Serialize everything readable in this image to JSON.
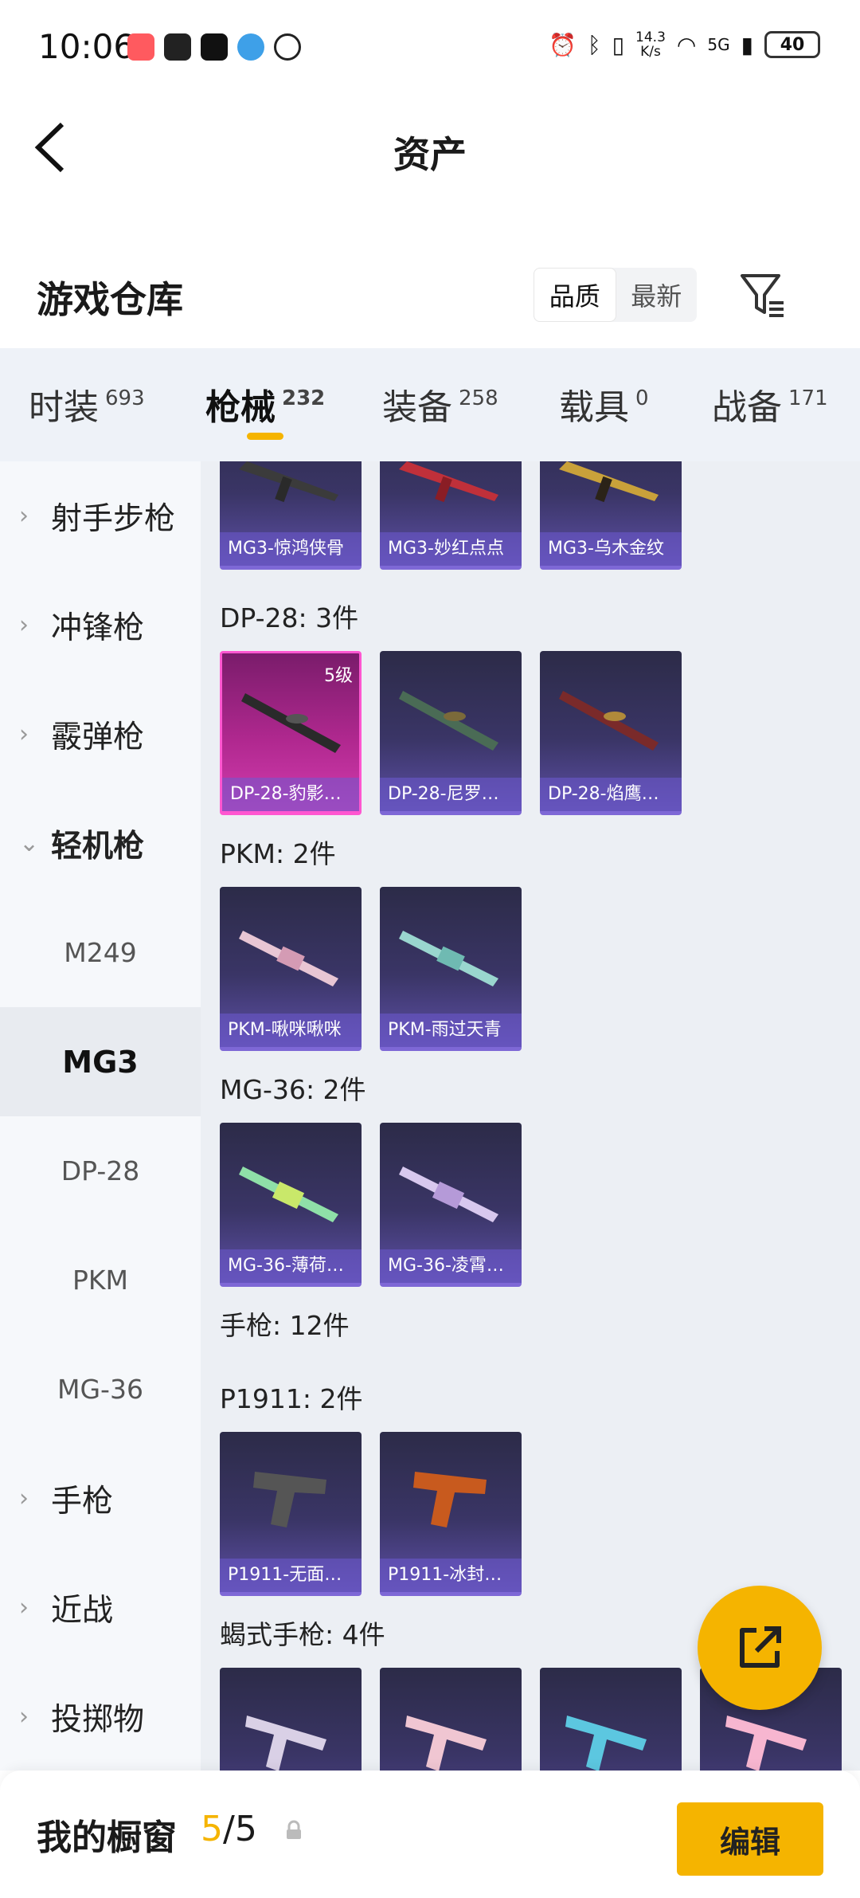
{
  "status": {
    "time": "10:06",
    "net_speed_top": "14.3",
    "net_speed_bottom": "K/s",
    "network": "5G",
    "battery": "40"
  },
  "header": {
    "title": "资产"
  },
  "warehouse": {
    "title": "游戏仓库",
    "sort_quality": "品质",
    "sort_latest": "最新"
  },
  "categories": [
    {
      "label": "时装",
      "count": "693"
    },
    {
      "label": "枪械",
      "count": "232"
    },
    {
      "label": "装备",
      "count": "258"
    },
    {
      "label": "载具",
      "count": "0"
    },
    {
      "label": "战备",
      "count": "171"
    }
  ],
  "sidenav": [
    {
      "label": "射手步枪"
    },
    {
      "label": "冲锋枪"
    },
    {
      "label": "霰弹枪"
    },
    {
      "label": "轻机枪"
    },
    {
      "label": "M249"
    },
    {
      "label": "MG3"
    },
    {
      "label": "DP-28"
    },
    {
      "label": "PKM"
    },
    {
      "label": "MG-36"
    },
    {
      "label": "手枪"
    },
    {
      "label": "近战"
    },
    {
      "label": "投掷物"
    }
  ],
  "groups": {
    "dp28": "DP-28: 3件",
    "pkm": "PKM: 2件",
    "mg36": "MG-36: 2件",
    "pistol": "手枪: 12件",
    "p1911": "P1911: 2件",
    "scorpion": "蝎式手枪: 4件"
  },
  "cards": {
    "mg3_1": "MG3-惊鸿侠骨",
    "mg3_2": "MG3-妙红点点",
    "mg3_3": "MG3-乌木金纹",
    "dp28_1": "DP-28-豹影…",
    "dp28_1_level": "5级",
    "dp28_2": "DP-28-尼罗…",
    "dp28_3": "DP-28-焰鹰…",
    "pkm_1": "PKM-啾咪啾咪",
    "pkm_2": "PKM-雨过天青",
    "mg36_1": "MG-36-薄荷…",
    "mg36_2": "MG-36-凌霄…",
    "p1911_1": "P1911-无面…",
    "p1911_2": "P1911-冰封…"
  },
  "bottom": {
    "showcase_label": "我的橱窗",
    "count_current": "5",
    "count_total": "/5",
    "edit_label": "编辑"
  },
  "colors": {
    "accent": "#f5b400",
    "card_purple": "#3a3566",
    "card_pink": "#b0288f"
  }
}
